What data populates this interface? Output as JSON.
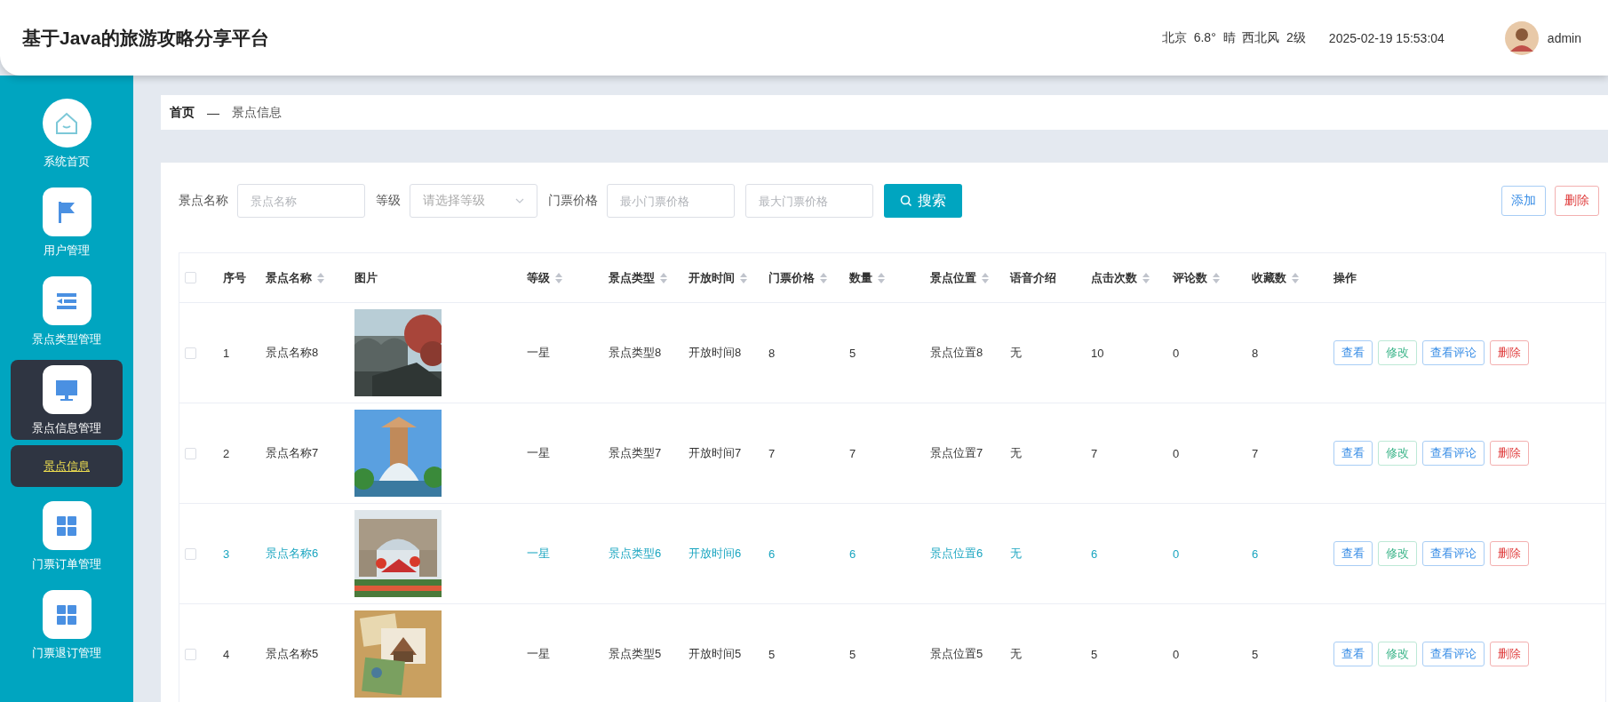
{
  "header": {
    "title": "基于Java的旅游攻略分享平台",
    "weather": "北京  6.8°  晴  西北风  2级",
    "datetime": "2025-02-19 15:53:04",
    "user": "admin"
  },
  "sidebar": {
    "items": [
      {
        "label": "系统首页",
        "selected": false
      },
      {
        "label": "用户管理",
        "selected": false
      },
      {
        "label": "景点类型管理",
        "selected": false
      },
      {
        "label": "景点信息管理",
        "selected": true,
        "expanded": true,
        "children": [
          {
            "label": "景点信息",
            "selected": true
          }
        ]
      },
      {
        "label": "门票订单管理",
        "selected": false
      },
      {
        "label": "门票退订管理",
        "selected": false
      }
    ]
  },
  "breadcrumb": {
    "home": "首页",
    "separator": "—",
    "current": "景点信息"
  },
  "search": {
    "fields": [
      {
        "label": "景点名称",
        "kind": "input",
        "placeholder": "景点名称"
      },
      {
        "label": "等级",
        "kind": "select",
        "placeholder": "请选择等级"
      },
      {
        "label": "门票价格",
        "kind": "input",
        "placeholder": "最小门票价格"
      },
      {
        "kind": "input",
        "placeholder": "最大门票价格"
      }
    ],
    "button": "搜索",
    "actions": [
      {
        "label": "添加",
        "kind": "add"
      },
      {
        "label": "删除",
        "kind": "delete"
      }
    ]
  },
  "table": {
    "select_all": {
      "checked": false
    },
    "columns": [
      {
        "label": "序号",
        "sortable": false
      },
      {
        "label": "景点名称",
        "sortable": true
      },
      {
        "label": "图片",
        "sortable": false
      },
      {
        "label": "等级",
        "sortable": true
      },
      {
        "label": "景点类型",
        "sortable": true
      },
      {
        "label": "开放时间",
        "sortable": true
      },
      {
        "label": "门票价格",
        "sortable": true
      },
      {
        "label": "数量",
        "sortable": true
      },
      {
        "label": "景点位置",
        "sortable": true
      },
      {
        "label": "语音介绍",
        "sortable": false
      },
      {
        "label": "点击次数",
        "sortable": true
      },
      {
        "label": "评论数",
        "sortable": true
      },
      {
        "label": "收藏数",
        "sortable": true
      },
      {
        "label": "操作",
        "sortable": false
      }
    ],
    "rows": [
      {
        "checked": false,
        "selected": false,
        "cells": [
          "1",
          "景点名称8",
          null,
          "一星",
          "景点类型8",
          "开放时间8",
          "8",
          "5",
          "景点位置8",
          "无",
          "10",
          "0",
          "8"
        ],
        "actions": [
          {
            "label": "查看",
            "kind": "view"
          },
          {
            "label": "修改",
            "kind": "edit"
          },
          {
            "label": "查看评论",
            "kind": "view"
          },
          {
            "label": "删除",
            "kind": "delete"
          }
        ]
      },
      {
        "checked": false,
        "selected": false,
        "cells": [
          "2",
          "景点名称7",
          null,
          "一星",
          "景点类型7",
          "开放时间7",
          "7",
          "7",
          "景点位置7",
          "无",
          "7",
          "0",
          "7"
        ],
        "actions": [
          {
            "label": "查看",
            "kind": "view"
          },
          {
            "label": "修改",
            "kind": "edit"
          },
          {
            "label": "查看评论",
            "kind": "view"
          },
          {
            "label": "删除",
            "kind": "delete"
          }
        ]
      },
      {
        "checked": false,
        "selected": true,
        "cells": [
          "3",
          "景点名称6",
          null,
          "一星",
          "景点类型6",
          "开放时间6",
          "6",
          "6",
          "景点位置6",
          "无",
          "6",
          "0",
          "6"
        ],
        "actions": [
          {
            "label": "查看",
            "kind": "view"
          },
          {
            "label": "修改",
            "kind": "edit"
          },
          {
            "label": "查看评论",
            "kind": "view"
          },
          {
            "label": "删除",
            "kind": "delete"
          }
        ]
      },
      {
        "checked": false,
        "selected": false,
        "cells": [
          "4",
          "景点名称5",
          null,
          "一星",
          "景点类型5",
          "开放时间5",
          "5",
          "5",
          "景点位置5",
          "无",
          "5",
          "0",
          "5"
        ],
        "actions": [
          {
            "label": "查看",
            "kind": "view"
          },
          {
            "label": "修改",
            "kind": "edit"
          },
          {
            "label": "查看评论",
            "kind": "view"
          },
          {
            "label": "删除",
            "kind": "delete"
          }
        ]
      }
    ]
  }
}
